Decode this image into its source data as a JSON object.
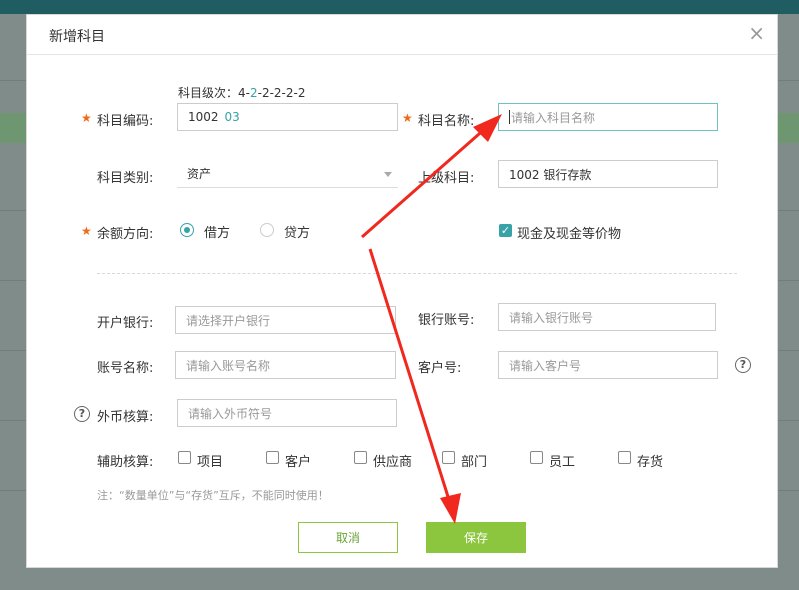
{
  "dialog": {
    "title": "新增科目",
    "close": "×"
  },
  "form": {
    "code_level_hint": {
      "prefix": "科目级次：",
      "first": "4-",
      "second": "2",
      "rest": "-2-2-2-2"
    },
    "subject_code": {
      "label": "科目编码:",
      "value": "1002",
      "suffix": "03"
    },
    "subject_name": {
      "label": "科目名称:",
      "placeholder": "请输入科目名称"
    },
    "subject_category": {
      "label": "科目类别:",
      "value": "资产"
    },
    "parent_subject": {
      "label": "上级科目:",
      "value": "1002 银行存款"
    },
    "balance_direction": {
      "label": "余额方向:",
      "options": [
        "借方",
        "贷方"
      ],
      "selected": "借方"
    },
    "cash_equivalent": {
      "label": "现金及现金等价物",
      "checked": true
    },
    "bank": {
      "label": "开户银行:",
      "placeholder": "请选择开户银行"
    },
    "bank_account": {
      "label": "银行账号:",
      "placeholder": "请输入银行账号"
    },
    "account_name": {
      "label": "账号名称:",
      "placeholder": "请输入账号名称"
    },
    "customer_no": {
      "label": "客户号:",
      "placeholder": "请输入客户号"
    },
    "foreign_currency": {
      "label": "外币核算:",
      "placeholder": "请输入外币符号"
    },
    "auxiliary": {
      "label": "辅助核算:",
      "items": [
        "项目",
        "客户",
        "供应商",
        "部门",
        "员工",
        "存货"
      ]
    },
    "note": "注：“数量单位”与“存货”互斥，不能同时使用！",
    "help_glyph": "?",
    "required_mark": "★",
    "check_glyph": "✓"
  },
  "buttons": {
    "cancel": "取消",
    "save": "保存"
  },
  "colors": {
    "accent": "#37a2a8",
    "save_button": "#8cc63e",
    "required": "#f06a19",
    "annotation_arrow": "#f0281e"
  }
}
